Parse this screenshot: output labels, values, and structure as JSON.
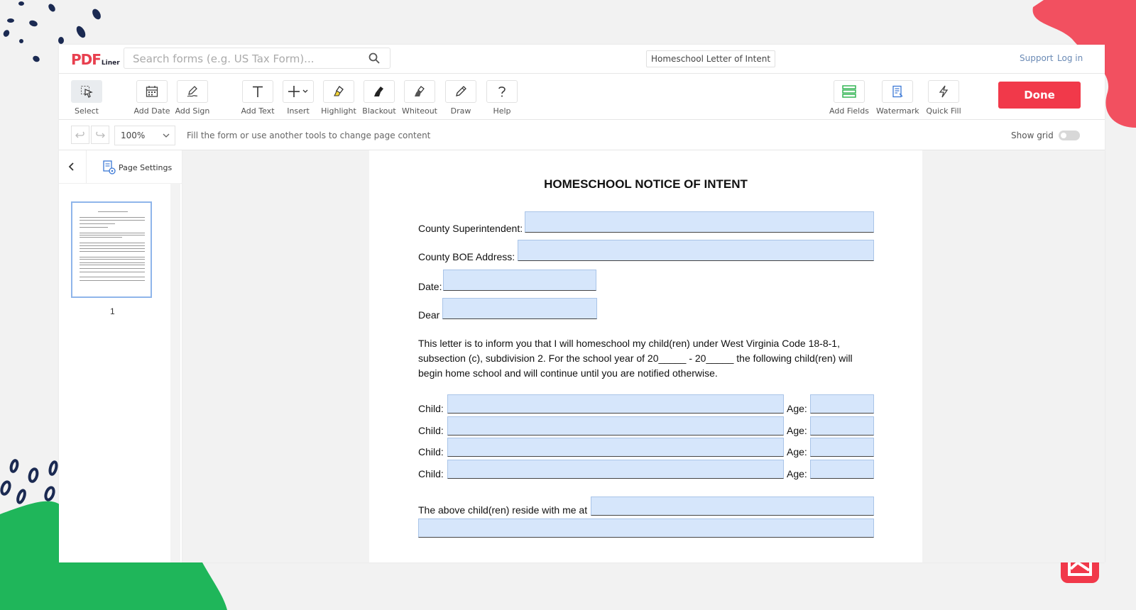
{
  "app": {
    "logo_main": "PDF",
    "logo_sub": "Liner",
    "search_placeholder": "Search forms (e.g. US Tax Form)...",
    "document_name": "Homeschool Letter of Intent",
    "support_label": "Support",
    "login_label": "Log in"
  },
  "toolbar": {
    "select": "Select",
    "add_date": "Add Date",
    "add_sign": "Add Sign",
    "add_text": "Add Text",
    "insert": "Insert",
    "highlight": "Highlight",
    "blackout": "Blackout",
    "whiteout": "Whiteout",
    "draw": "Draw",
    "help": "Help",
    "add_fields": "Add Fields",
    "watermark": "Watermark",
    "quick_fill": "Quick Fill",
    "done": "Done"
  },
  "subbar": {
    "zoom": "100%",
    "hint": "Fill the form or use another tools to change page content",
    "show_grid": "Show grid",
    "show_grid_on": false
  },
  "sidebar": {
    "page_settings": "Page Settings",
    "pages": [
      "1"
    ]
  },
  "document": {
    "title": "HOMESCHOOL NOTICE OF INTENT",
    "county_superintendent_label": "County Superintendent:",
    "county_boe_label": "County BOE Address:",
    "date_label": "Date:",
    "dear_label": "Dear",
    "paragraph": "This letter is to inform you that I will homeschool my child(ren) under West Virginia Code 18-8-1, subsection (c), subdivision 2. For the school year of 20_____ - 20_____ the following child(ren) will begin home school and will continue until you are notified otherwise.",
    "child_label": "Child:",
    "age_label": "Age:",
    "reside_label": "The above child(ren) reside with me at"
  },
  "colors": {
    "brand_red": "#f1394a",
    "field_fill": "#d6e6fb",
    "link_blue": "#6a8ab5",
    "deco_navy": "#1b2a52",
    "deco_green": "#1fb65a"
  }
}
